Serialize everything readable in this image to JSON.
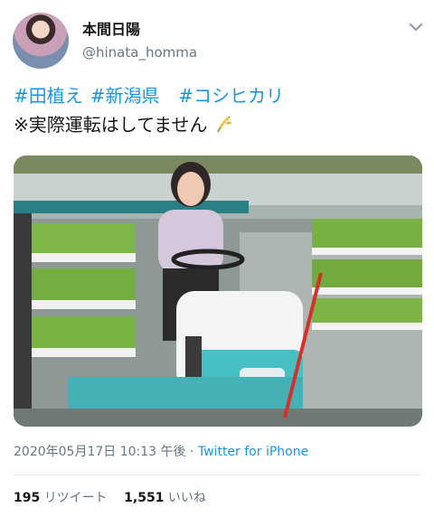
{
  "tweet": {
    "author": {
      "display_name": "本間日陽",
      "handle": "@hinata_homma"
    },
    "hashtags": [
      "#田植え",
      "#新潟県",
      "#コシヒカリ"
    ],
    "text_line2": "※実際運転はしてません",
    "emoji_icon": "rice-plant-icon",
    "timestamp": "2020年05月17日 10:13 午後",
    "separator": " · ",
    "source": "Twitter for iPhone",
    "retweets": {
      "count": "195",
      "label": "リツイート"
    },
    "likes": {
      "count": "1,551",
      "label": "いいね"
    }
  },
  "colors": {
    "link": "#1b95e0",
    "muted": "#657786",
    "text": "#14171a"
  }
}
